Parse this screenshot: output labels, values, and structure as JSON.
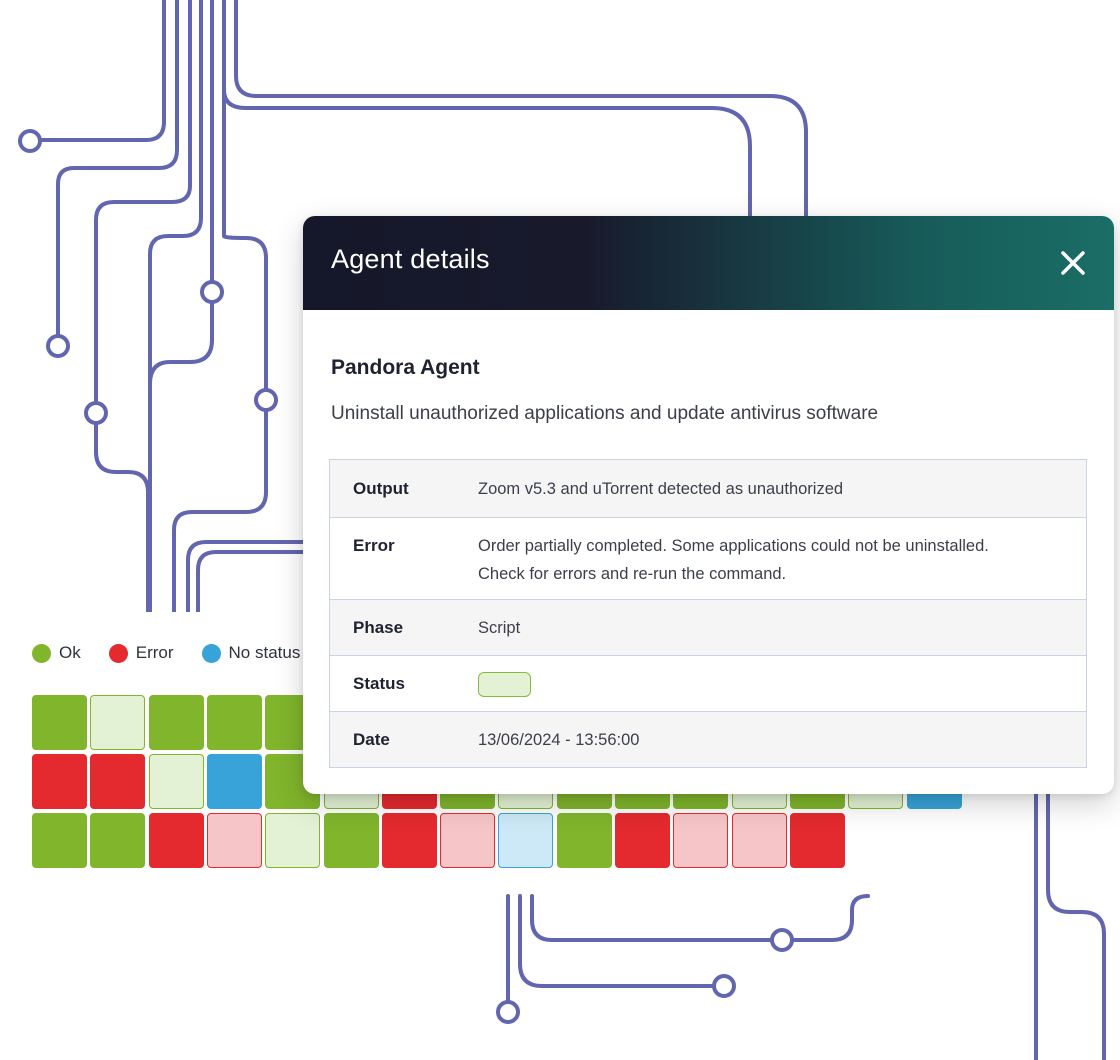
{
  "modal": {
    "title": "Agent details",
    "agent_name": "Pandora Agent",
    "description": "Uninstall unauthorized applications and update antivirus software",
    "details": [
      {
        "label": "Output",
        "value": "Zoom v5.3 and uTorrent detected as unauthorized"
      },
      {
        "label": "Error",
        "value": "Order partially completed. Some applications could not be uninstalled.",
        "value2": "Check for errors and re-run the command."
      },
      {
        "label": "Phase",
        "value": "Script"
      },
      {
        "label": "Status",
        "status": "ok"
      },
      {
        "label": "Date",
        "value": "13/06/2024 - 13:56:00"
      }
    ]
  },
  "legend": [
    {
      "label": "Ok",
      "color": "#80b52c"
    },
    {
      "label": "Error",
      "color": "#e42a2e"
    },
    {
      "label": "No status",
      "color": "#37a3d8"
    }
  ],
  "colors": {
    "ok": "#80b52c",
    "ok_light": "#e3f2d4",
    "error": "#e42a2e",
    "error_light": "#f6c5c7",
    "nostatus": "#37a3d8",
    "nostatus_light": "#cde8f6",
    "circuit": "#6266ae"
  },
  "status_grid": [
    [
      "ok",
      "ok_light",
      "ok",
      "ok",
      "ok",
      "ok",
      "ok",
      "ok",
      "ok",
      "ok",
      "ok",
      "ok",
      "ok",
      "ok",
      "ok",
      "ok"
    ],
    [
      "error",
      "error",
      "ok_light",
      "nostatus",
      "ok",
      "ok_light",
      "error",
      "ok",
      "ok_light",
      "ok",
      "ok",
      "ok",
      "ok_light",
      "ok",
      "ok_light",
      "nostatus"
    ],
    [
      "ok",
      "ok",
      "error",
      "error_light",
      "ok_light",
      "ok",
      "error",
      "error_light",
      "nostatus_light",
      "ok",
      "error",
      "error_light",
      "error_light",
      "error"
    ]
  ]
}
